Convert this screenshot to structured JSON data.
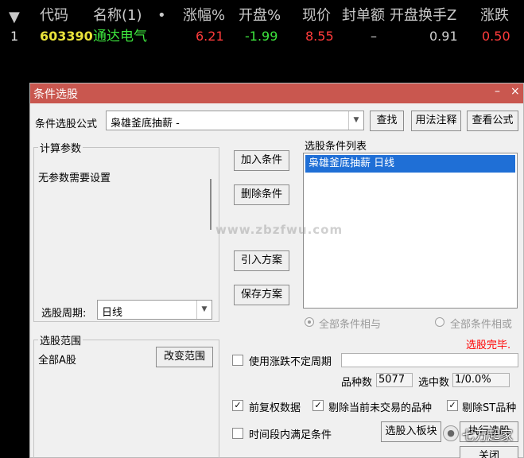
{
  "quote_table": {
    "headers": [
      "代码",
      "名称(1)",
      "•",
      "涨幅%",
      "开盘%",
      "现价",
      "封单额",
      "开盘换手Z",
      "涨跌"
    ],
    "row": {
      "index": "1",
      "code": "603390",
      "name": "通达电气",
      "change_pct": "6.21",
      "open_pct": "-1.99",
      "price": "8.55",
      "seal_amount": "–",
      "open_turnover": "0.91",
      "change": "0.50"
    }
  },
  "dialog": {
    "title": "条件选股",
    "formula_label": "条件选股公式",
    "formula_value": "枭雄釜底抽薪 -",
    "buttons": {
      "find": "查找",
      "usage_notes": "用法注释",
      "view_formula": "查看公式",
      "add_condition": "加入条件",
      "delete_condition": "删除条件",
      "import_scheme": "引入方案",
      "save_scheme": "保存方案",
      "change_range": "改变范围",
      "to_board": "选股入板块",
      "execute": "执行选股",
      "close": "关闭"
    },
    "params_group": {
      "title": "计算参数",
      "text": "无参数需要设置",
      "period_label": "选股周期:",
      "period_value": "日线"
    },
    "conditions_group": {
      "title": "选股条件列表",
      "items": [
        "枭雄釜底抽薪  日线"
      ]
    },
    "logic": {
      "and_label": "全部条件相与",
      "or_label": "全部条件相或"
    },
    "status": "选股完毕.",
    "range_group": {
      "title": "选股范围",
      "value": "全部A股"
    },
    "uncertain_period_label": "使用涨跌不定周期",
    "counts": {
      "total_label": "品种数",
      "total_value": "5077",
      "selected_label": "选中数",
      "selected_value": "1/0.0%"
    },
    "options": {
      "forward_adjust": "前复权数据",
      "exclude_untraded": "剔除当前未交易的品种",
      "exclude_st": "剔除ST品种",
      "period_condition": "时间段内满足条件"
    },
    "window_controls": {
      "minimize": "–",
      "close": "×"
    }
  },
  "watermark": "www.zbzfwu.com",
  "overlay_caption": "七万起家",
  "colors": {
    "titlebar": "#c9574f",
    "up": "#ff3b3b",
    "down": "#3ee63e",
    "code": "#e8e23a",
    "name": "#3ee63e",
    "status": "#ff0000",
    "selection": "#1f6fd6"
  }
}
